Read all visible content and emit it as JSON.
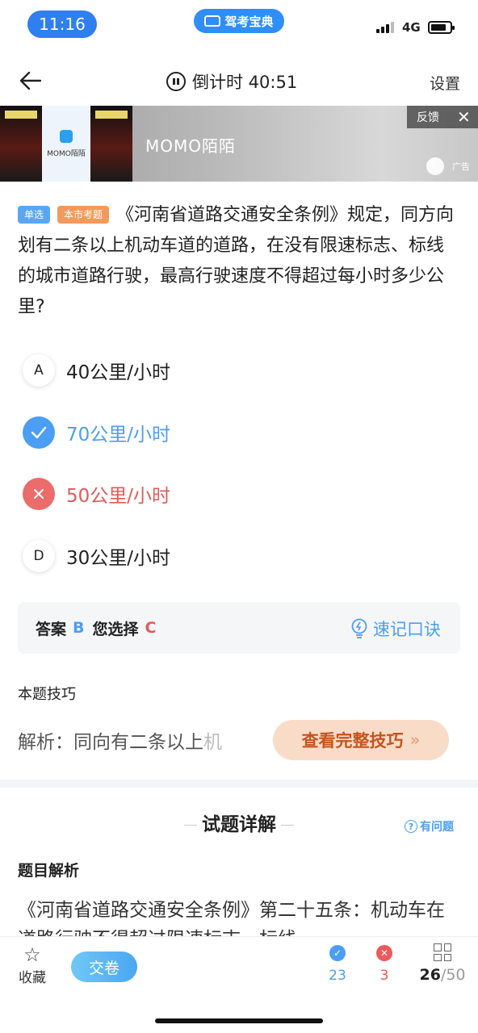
{
  "status_bar": {
    "time": "11:16",
    "brand": "驾考宝典",
    "network": "4G"
  },
  "nav": {
    "countdown": "倒计时 40:51",
    "settings": "设置"
  },
  "ad": {
    "thumb_label": "MOMO陌陌",
    "name": "MOMO陌陌",
    "feedback": "反馈",
    "close": "✕",
    "ad_label": "广告"
  },
  "question": {
    "tags": [
      "单选",
      "本市考题"
    ],
    "text": "《河南省道路交通安全条例》规定，同方向划有二条以上机动车道的道路，在没有限速标志、标线的城市道路行驶，最高行驶速度不得超过每小时多少公里?"
  },
  "options": [
    {
      "letter": "A",
      "text": "40公里/小时",
      "state": "normal"
    },
    {
      "letter": "✓",
      "text": "70公里/小时",
      "state": "correct"
    },
    {
      "letter": "✕",
      "text": "50公里/小时",
      "state": "wrong"
    },
    {
      "letter": "D",
      "text": "30公里/小时",
      "state": "normal"
    }
  ],
  "answer": {
    "label": "答案",
    "correct": "B",
    "chosen_label": "您选择",
    "chosen": "C",
    "mnemonic": "速记口诀"
  },
  "tips": {
    "title": "本题技巧",
    "text": "解析：同向有二条以上",
    "text_fade": "机",
    "button": "查看完整技巧",
    "button_arrows": "»"
  },
  "detail": {
    "title": "试题详解",
    "has_question": "有问题",
    "analysis_title": "题目解析",
    "analysis_text": "《河南省道路交通安全条例》第二十五条：机动车在道路行驶不得超过限速标志、标线"
  },
  "bottom": {
    "favorite": "收藏",
    "submit": "交卷",
    "correct_count": "23",
    "wrong_count": "3",
    "current": "26",
    "total": "/50"
  },
  "colors": {
    "accent": "#4b9ef4",
    "error": "#e25a5a",
    "tip": "#c4541d"
  }
}
